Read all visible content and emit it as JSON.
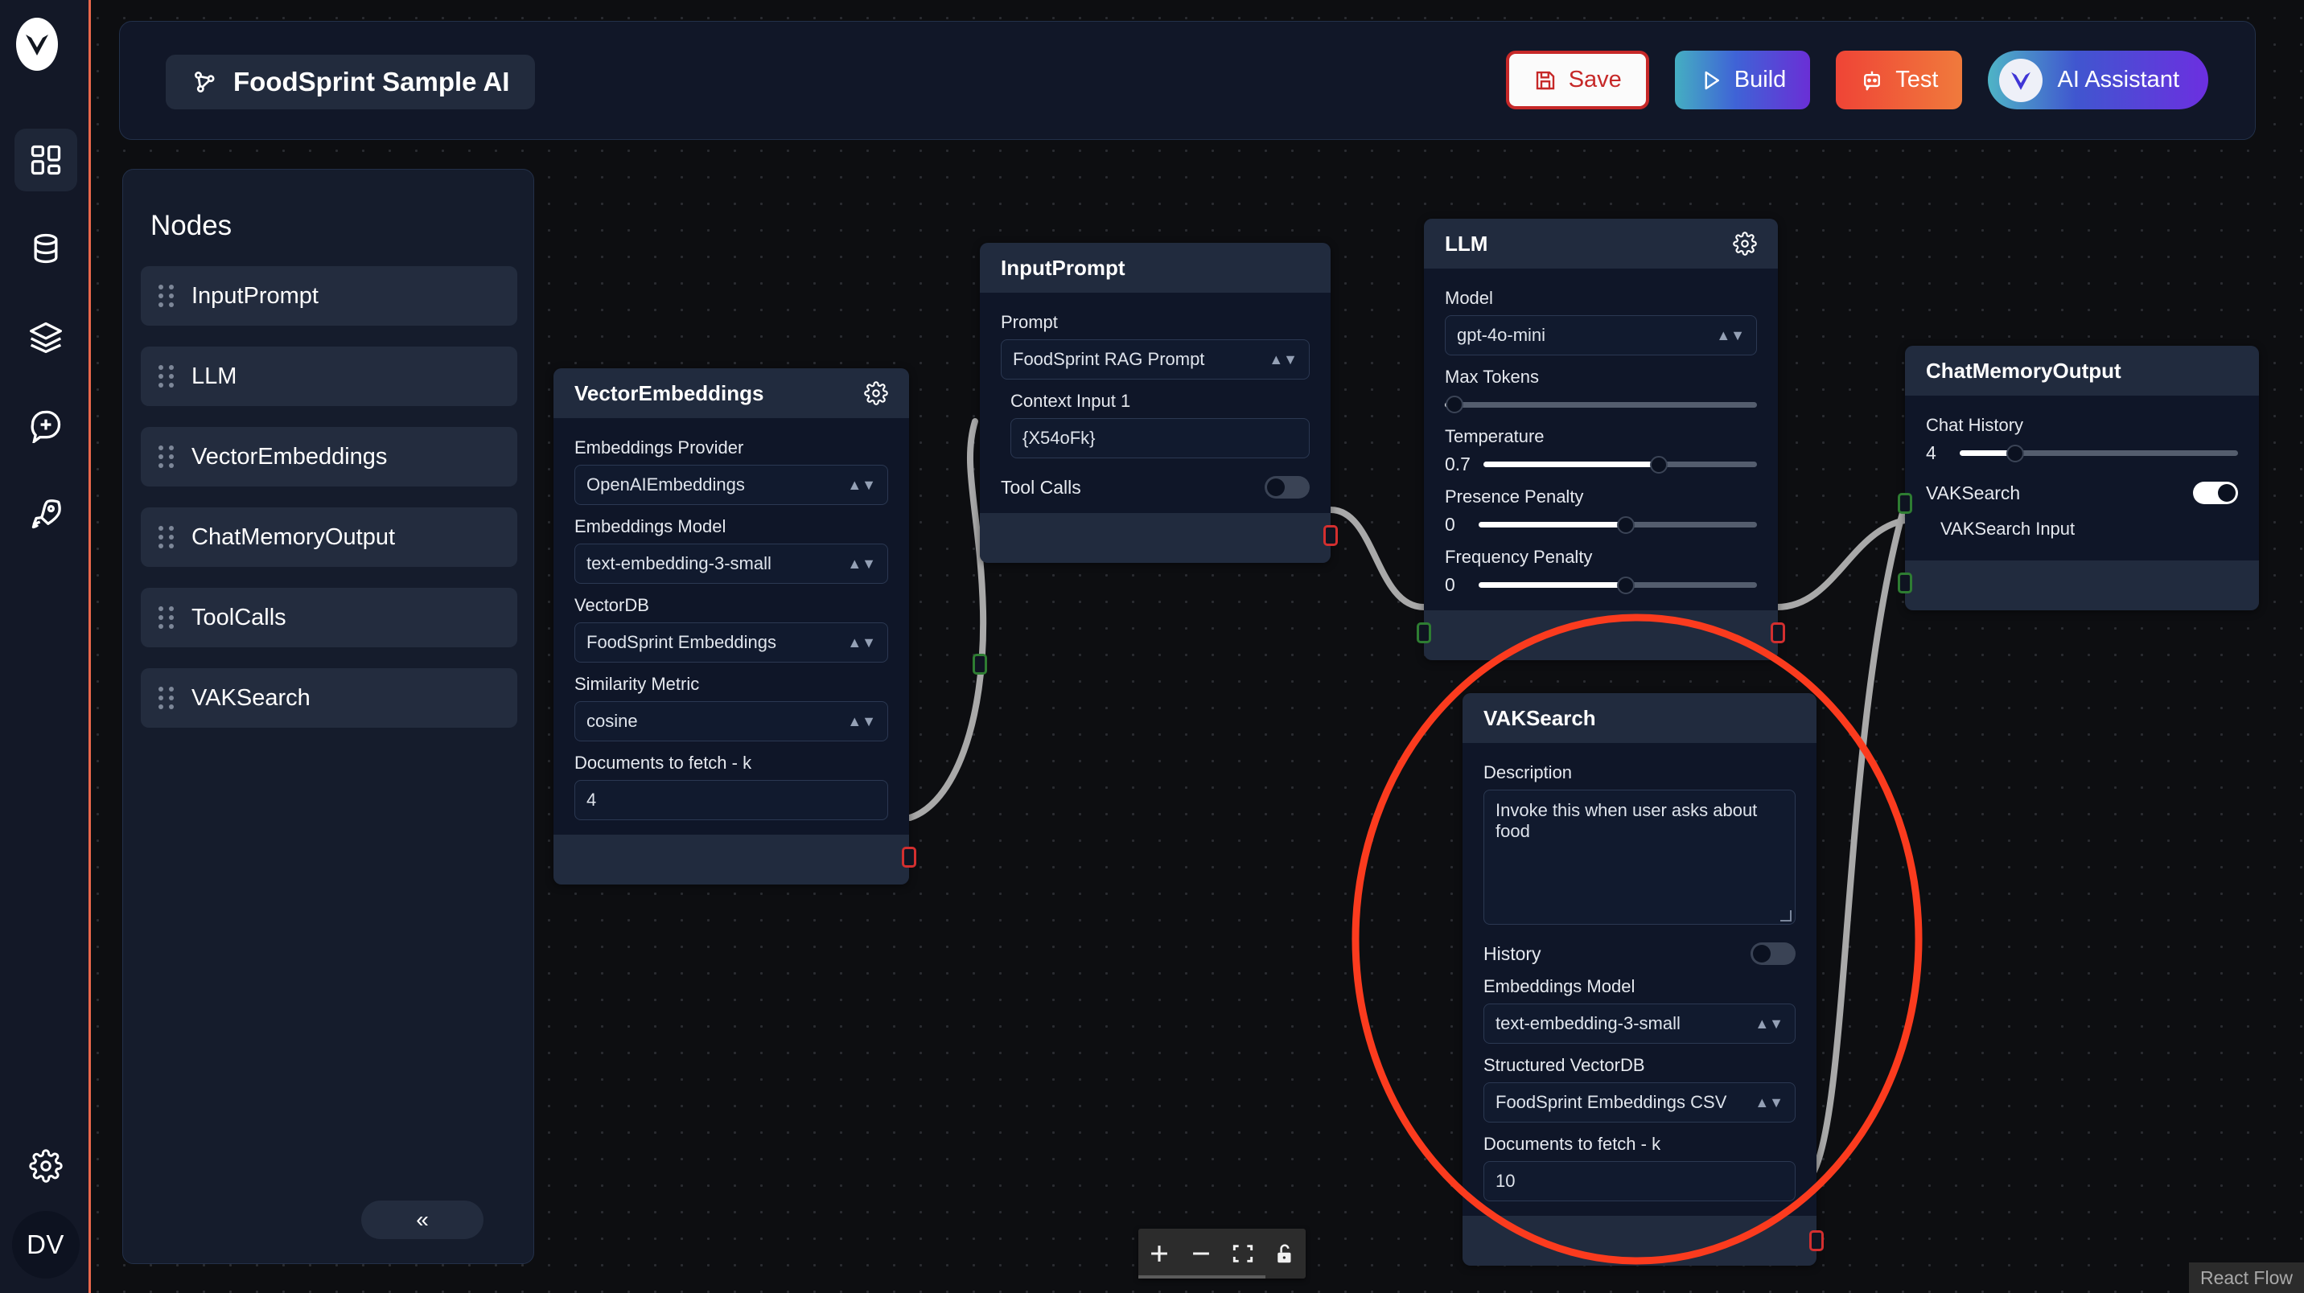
{
  "app": {
    "logo_icon": "chevron-v-logo",
    "rail_icons": [
      {
        "name": "dashboard-grid-icon",
        "active": true
      },
      {
        "name": "database-icon",
        "active": false
      },
      {
        "name": "layers-icon",
        "active": false
      },
      {
        "name": "chat-plus-icon",
        "active": false
      },
      {
        "name": "rocket-icon",
        "active": false
      }
    ],
    "settings_icon": "gear-icon",
    "avatar_initials": "DV"
  },
  "header": {
    "flow_icon": "workflow-nodes-icon",
    "flow_title": "FoodSprint Sample AI",
    "buttons": {
      "save": {
        "label": "Save",
        "icon": "save-disk-icon",
        "color": "#c62828"
      },
      "build": {
        "label": "Build",
        "icon": "play-triangle-icon"
      },
      "test": {
        "label": "Test",
        "icon": "robot-icon"
      },
      "ai_assistant": {
        "label": "AI Assistant",
        "icon": "chevron-v-logo"
      }
    }
  },
  "sidebar": {
    "title": "Nodes",
    "items": [
      {
        "label": "InputPrompt"
      },
      {
        "label": "LLM"
      },
      {
        "label": "VectorEmbeddings"
      },
      {
        "label": "ChatMemoryOutput"
      },
      {
        "label": "ToolCalls"
      },
      {
        "label": "VAKSearch"
      }
    ],
    "collapse_label": "«"
  },
  "nodes": {
    "vector_embeddings": {
      "title": "VectorEmbeddings",
      "gear_icon": "gear-icon",
      "fields": {
        "embeddings_provider_label": "Embeddings Provider",
        "embeddings_provider_value": "OpenAIEmbeddings",
        "embeddings_model_label": "Embeddings Model",
        "embeddings_model_value": "text-embedding-3-small",
        "vectordb_label": "VectorDB",
        "vectordb_value": "FoodSprint Embeddings",
        "similarity_metric_label": "Similarity Metric",
        "similarity_metric_value": "cosine",
        "documents_k_label": "Documents to fetch - k",
        "documents_k_value": "4"
      }
    },
    "input_prompt": {
      "title": "InputPrompt",
      "fields": {
        "prompt_label": "Prompt",
        "prompt_value": "FoodSprint RAG Prompt",
        "context_input_label": "Context Input 1",
        "context_input_value": "{X54oFk}",
        "tool_calls_label": "Tool Calls",
        "tool_calls_on": false
      }
    },
    "llm": {
      "title": "LLM",
      "gear_icon": "gear-icon",
      "fields": {
        "model_label": "Model",
        "model_value": "gpt-4o-mini",
        "max_tokens_label": "Max Tokens",
        "max_tokens_pct": 3,
        "temperature_label": "Temperature",
        "temperature_value": "0.7",
        "temperature_pct": 64,
        "presence_penalty_label": "Presence Penalty",
        "presence_penalty_value": "0",
        "presence_penalty_pct": 53,
        "frequency_penalty_label": "Frequency Penalty",
        "frequency_penalty_value": "0",
        "frequency_penalty_pct": 53
      }
    },
    "chat_memory_output": {
      "title": "ChatMemoryOutput",
      "fields": {
        "chat_history_label": "Chat History",
        "chat_history_value": "4",
        "chat_history_pct": 20,
        "vaksearch_label": "VAKSearch",
        "vaksearch_on": true,
        "vaksearch_input_label": "VAKSearch Input"
      }
    },
    "vak_search": {
      "title": "VAKSearch",
      "fields": {
        "description_label": "Description",
        "description_value": "Invoke this when user asks about food",
        "history_label": "History",
        "history_on": false,
        "embeddings_model_label": "Embeddings Model",
        "embeddings_model_value": "text-embedding-3-small",
        "structured_vectordb_label": "Structured VectorDB",
        "structured_vectordb_value": "FoodSprint Embeddings CSV",
        "documents_k_label": "Documents to fetch - k",
        "documents_k_value": "10"
      }
    }
  },
  "annotation": {
    "shape": "ellipse-highlight",
    "color": "#fb3b1e",
    "target": "VAKSearch"
  },
  "flow_controls": {
    "zoom_in": "+",
    "zoom_out": "−",
    "fit_view": "fit-view-icon",
    "lock": "unlock-icon"
  },
  "attribution": "React Flow"
}
